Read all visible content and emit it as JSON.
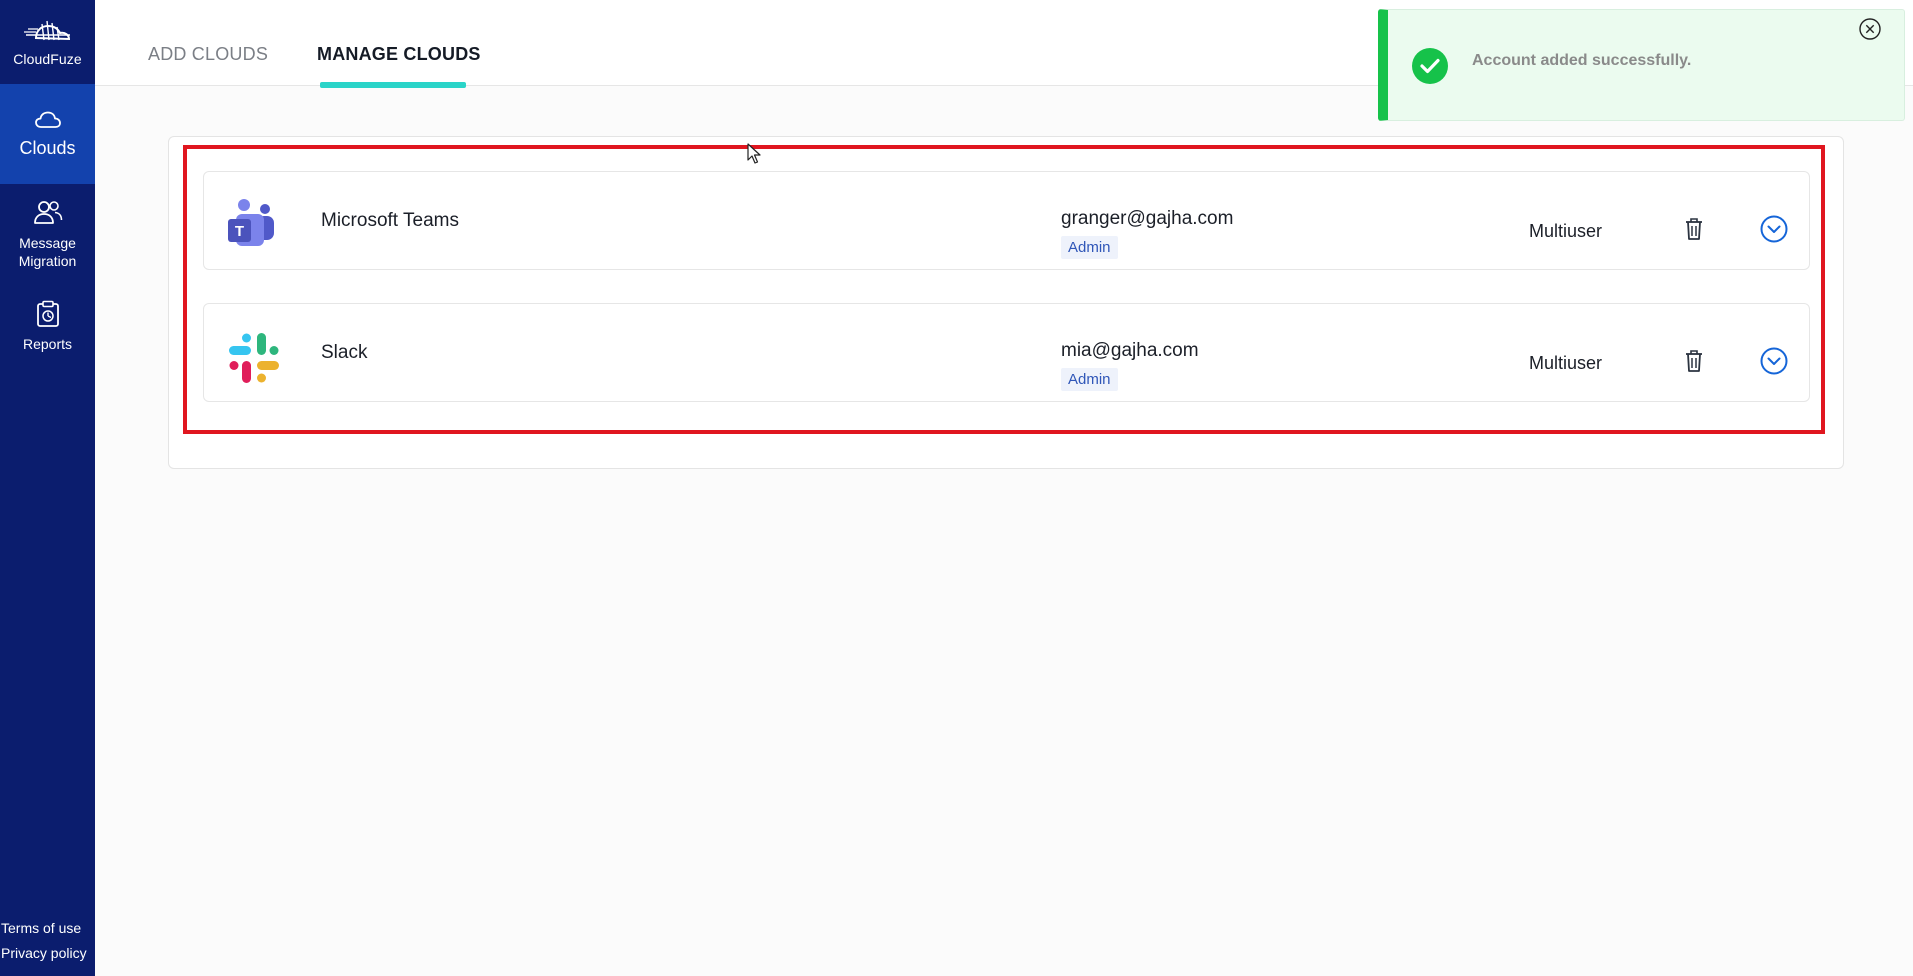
{
  "sidebar": {
    "brand": "CloudFuze",
    "items": [
      {
        "label": "Clouds",
        "icon": "cloud-icon",
        "active": true
      },
      {
        "label_line1": "Message",
        "label_line2": "Migration",
        "icon": "users-icon"
      },
      {
        "label": "Reports",
        "icon": "clipboard-icon"
      }
    ],
    "footer": {
      "terms": "Terms of use",
      "privacy": "Privacy policy"
    }
  },
  "tabs": {
    "add": "ADD CLOUDS",
    "manage": "MANAGE CLOUDS",
    "active": "manage"
  },
  "toast": {
    "message": "Account added successfully.",
    "icon": "check-circle-icon",
    "close_icon": "close-circle-icon"
  },
  "accounts": [
    {
      "app": "Microsoft Teams",
      "email": "granger@gajha.com",
      "role": "Admin",
      "type": "Multiuser",
      "icon": "microsoft-teams-icon"
    },
    {
      "app": "Slack",
      "email": "mia@gajha.com",
      "role": "Admin",
      "type": "Multiuser",
      "icon": "slack-icon"
    }
  ],
  "colors": {
    "sidebar": "#0b1d6e",
    "sidebar_active": "#1342ad",
    "tab_accent": "#2ad4c8",
    "success": "#16c24a",
    "highlight": "#e0161f",
    "link_blue": "#2f56b8"
  }
}
